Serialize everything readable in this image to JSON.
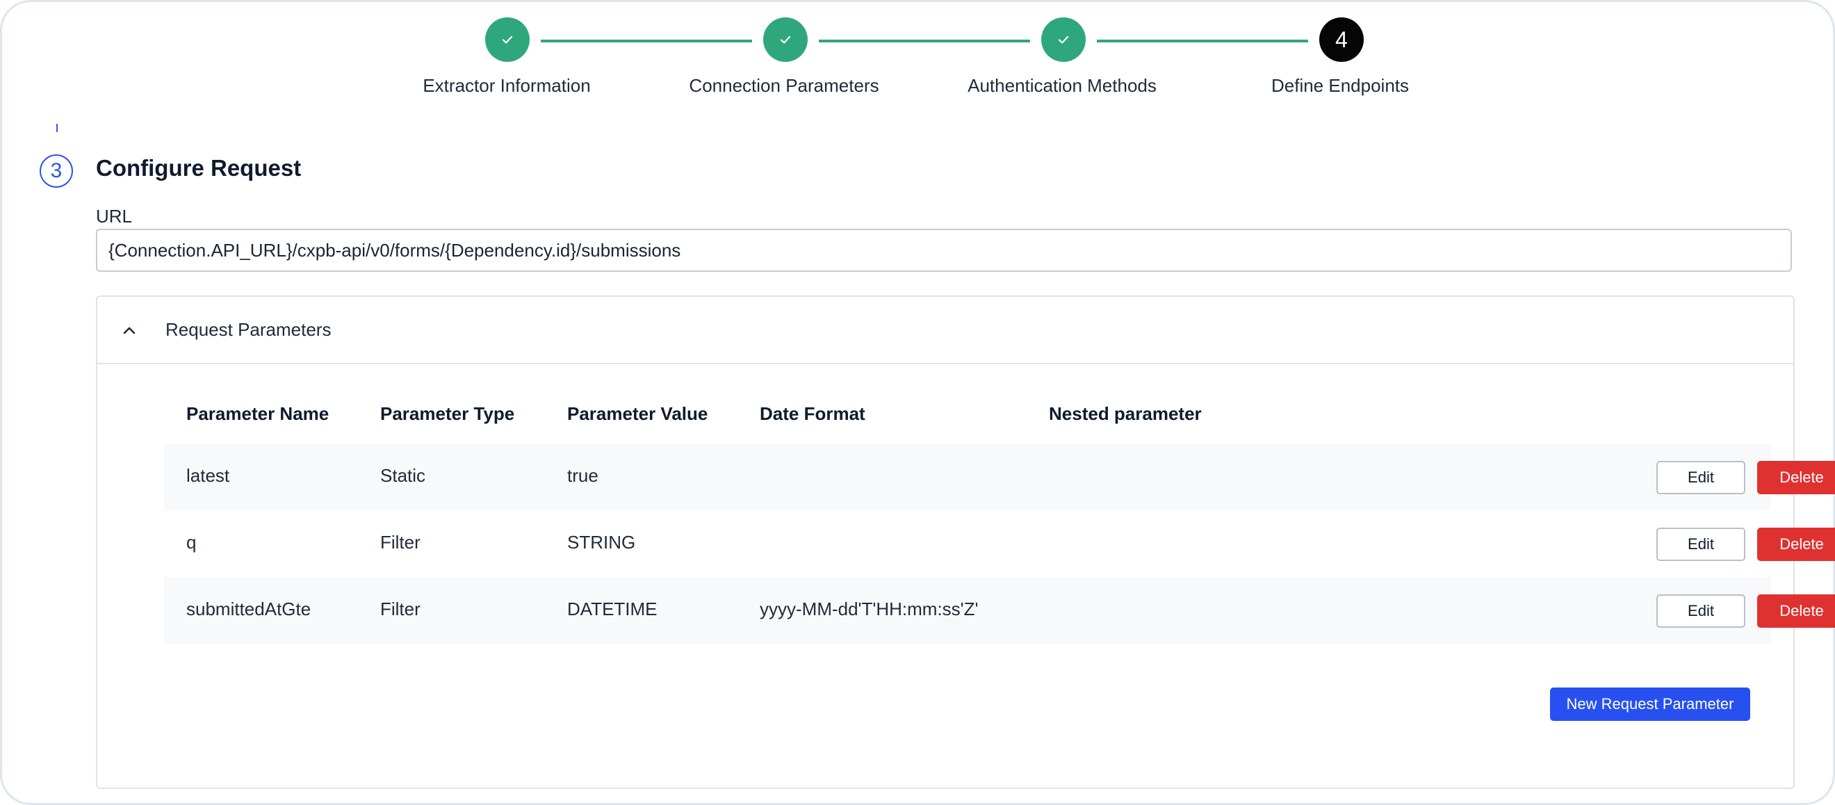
{
  "stepper": {
    "steps": [
      {
        "label": "Extractor Information",
        "status": "complete",
        "icon": "check-icon"
      },
      {
        "label": "Connection Parameters",
        "status": "complete",
        "icon": "check-icon"
      },
      {
        "label": "Authentication Methods",
        "status": "complete",
        "icon": "check-icon"
      },
      {
        "label": "Define Endpoints",
        "status": "current",
        "number": "4"
      }
    ]
  },
  "section": {
    "number": "3",
    "title": "Configure Request"
  },
  "url": {
    "label": "URL",
    "value": "{Connection.API_URL}/cxpb-api/v0/forms/{Dependency.id}/submissions"
  },
  "request_parameters": {
    "title": "Request Parameters",
    "expanded": true,
    "columns": [
      "Parameter Name",
      "Parameter Type",
      "Parameter Value",
      "Date Format",
      "Nested parameter"
    ],
    "rows": [
      {
        "name": "latest",
        "type": "Static",
        "value": "true",
        "date_format": "",
        "nested": ""
      },
      {
        "name": "q",
        "type": "Filter",
        "value": "STRING",
        "date_format": "",
        "nested": ""
      },
      {
        "name": "submittedAtGte",
        "type": "Filter",
        "value": "DATETIME",
        "date_format": "yyyy-MM-dd'T'HH:mm:ss'Z'",
        "nested": ""
      }
    ],
    "edit_label": "Edit",
    "delete_label": "Delete",
    "new_button_label": "New Request Parameter"
  },
  "colors": {
    "complete": "#2fa77d",
    "current": "#050505",
    "accent": "#2850f0",
    "danger": "#e03131"
  }
}
